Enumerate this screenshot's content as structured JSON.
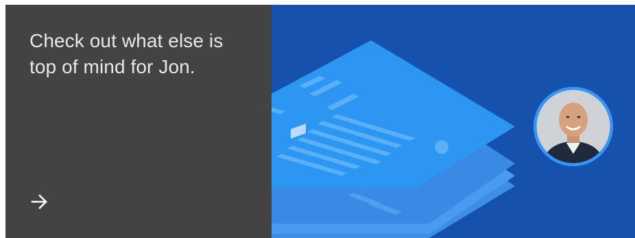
{
  "promo": {
    "headline": "Check out what else is top of mind for Jon.",
    "arrow_icon": "arrow-right-icon",
    "avatar_icon": "person-photo-avatar"
  },
  "colors": {
    "left_panel": "#434343",
    "right_panel": "#1652ad",
    "headline_text": "#e8e8e8",
    "accent": "#2e8cf0"
  }
}
